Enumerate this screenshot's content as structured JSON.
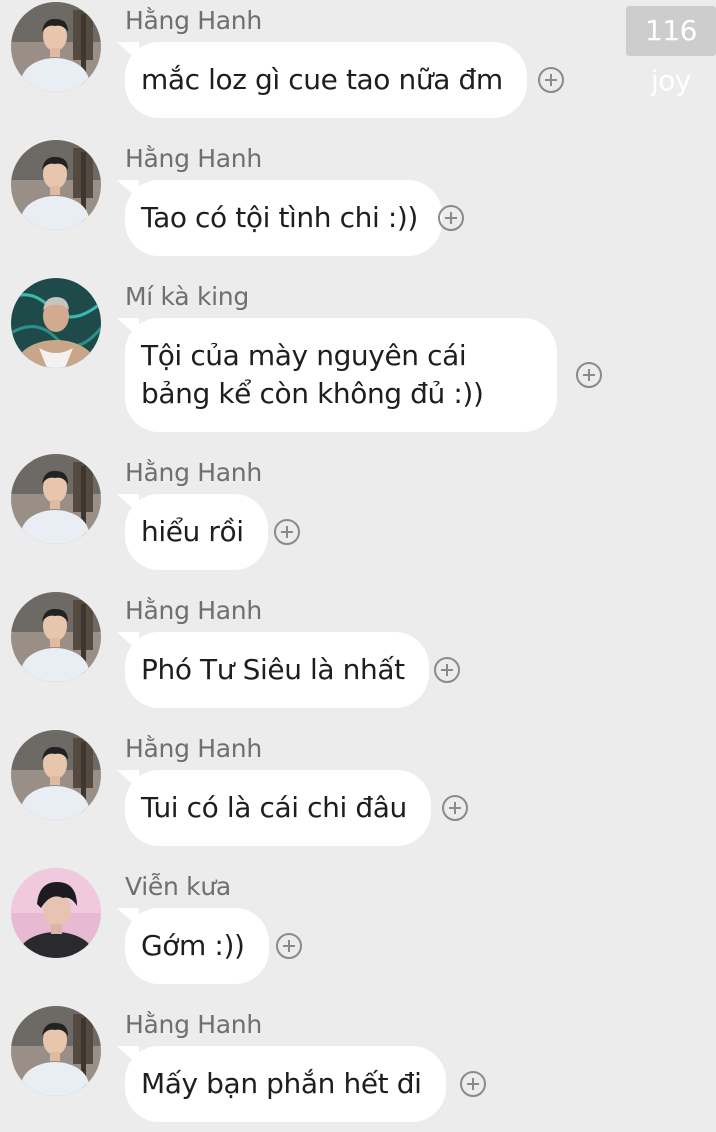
{
  "watermark": "116 joy",
  "messages": [
    {
      "sender": "Hằng Hanh",
      "text": "mắc loz gì cue tao nữa đm",
      "avatar": "boy-shirt-avatar"
    },
    {
      "sender": "Hằng Hanh",
      "text": "Tao có tội tình chi :))",
      "avatar": "boy-shirt-avatar"
    },
    {
      "sender": "Mí kà king",
      "text": "Tội của mày nguyên cái bảng kể còn không đủ :))",
      "avatar": "tank-top-avatar"
    },
    {
      "sender": "Hằng Hanh",
      "text": "hiểu rồi",
      "avatar": "boy-shirt-avatar"
    },
    {
      "sender": "Hằng Hanh",
      "text": "Phó Tư Siêu là nhất",
      "avatar": "boy-shirt-avatar"
    },
    {
      "sender": "Hằng Hanh",
      "text": "Tui có là cái chi đâu",
      "avatar": "boy-shirt-avatar"
    },
    {
      "sender": "Viễn kưa",
      "text": "Gớm :))",
      "avatar": "pink-bg-avatar"
    },
    {
      "sender": "Hằng Hanh",
      "text": "Mấy bạn phắn hết đi",
      "avatar": "boy-shirt-avatar"
    }
  ],
  "reaction_icon": "add-reaction-icon"
}
